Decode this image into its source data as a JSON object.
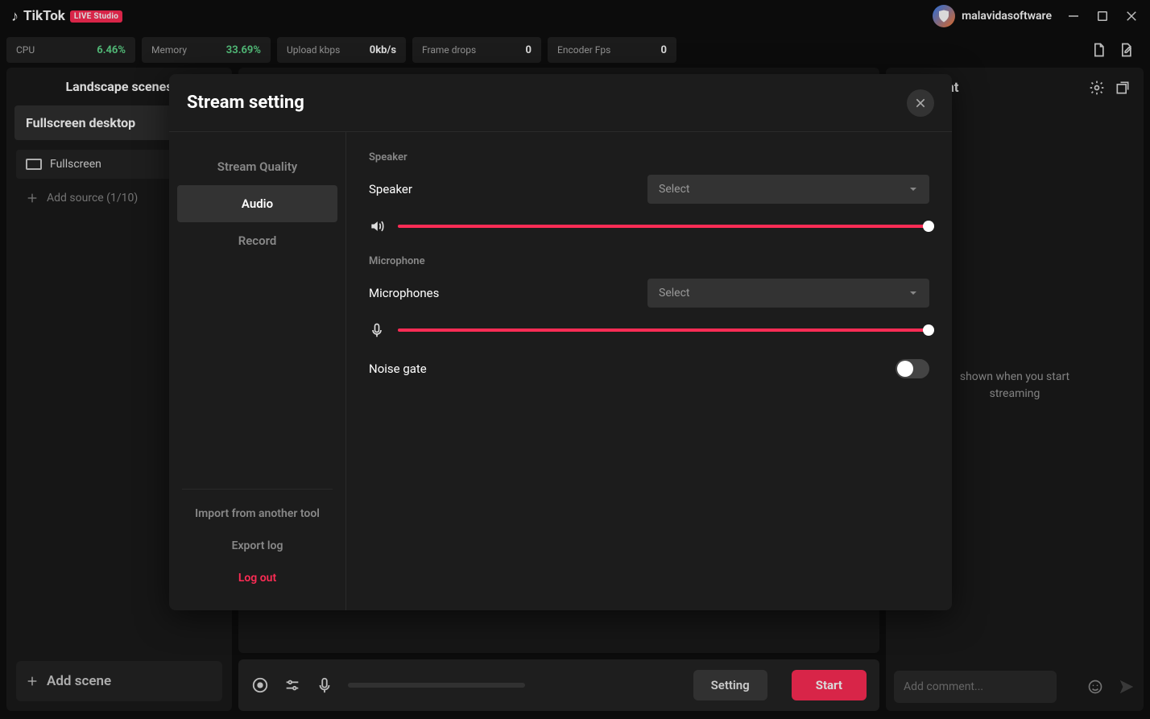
{
  "brand": {
    "name": "TikTok",
    "badge": "LIVE Studio"
  },
  "user": {
    "name": "malavidasoftware"
  },
  "stats": {
    "cpu_label": "CPU",
    "cpu_value": "6.46%",
    "mem_label": "Memory",
    "mem_value": "33.69%",
    "upload_label": "Upload kbps",
    "upload_value": "0kb/s",
    "drops_label": "Frame drops",
    "drops_value": "0",
    "fps_label": "Encoder Fps",
    "fps_value": "0"
  },
  "scenes": {
    "title": "Landscape scenes",
    "active": "Fullscreen desktop",
    "sources": {
      "fullscreen": "Fullscreen",
      "add": "Add source (1/10)"
    },
    "add_scene": "Add scene"
  },
  "bottom": {
    "setting": "Setting",
    "start": "Start"
  },
  "chat": {
    "title": "LIVE Chat",
    "empty1": "shown when you start",
    "empty2": "streaming",
    "placeholder": "Add comment..."
  },
  "modal": {
    "title": "Stream setting",
    "side": {
      "quality": "Stream Quality",
      "audio": "Audio",
      "record": "Record",
      "import": "Import from another tool",
      "export": "Export log",
      "logout": "Log out"
    },
    "audio": {
      "speaker_section": "Speaker",
      "speaker_label": "Speaker",
      "speaker_select": "Select",
      "mic_section": "Microphone",
      "mic_label": "Microphones",
      "mic_select": "Select",
      "noise_gate": "Noise gate"
    }
  }
}
